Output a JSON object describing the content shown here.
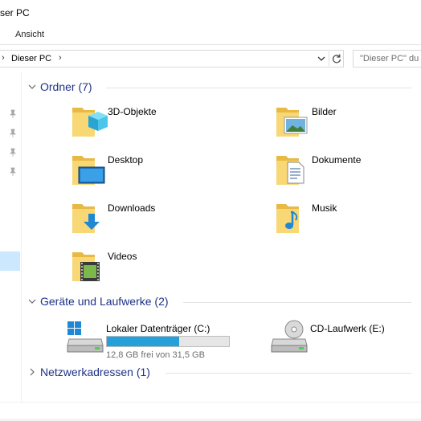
{
  "window": {
    "title": "ser PC"
  },
  "ribbon": {
    "tab_view": "Ansicht"
  },
  "address": {
    "crumb": "Dieser PC"
  },
  "search": {
    "placeholder": "\"Dieser PC\" du"
  },
  "groups": {
    "folders": {
      "title": "Ordner (7)",
      "expanded": true
    },
    "devices": {
      "title": "Geräte und Laufwerke (2)",
      "expanded": true
    },
    "network": {
      "title": "Netzwerkadressen (1)",
      "expanded": false
    }
  },
  "folders": [
    {
      "label": "3D-Objekte",
      "icon": "3d-objects-folder-icon"
    },
    {
      "label": "Bilder",
      "icon": "pictures-folder-icon"
    },
    {
      "label": "Desktop",
      "icon": "desktop-folder-icon"
    },
    {
      "label": "Dokumente",
      "icon": "documents-folder-icon"
    },
    {
      "label": "Downloads",
      "icon": "downloads-folder-icon"
    },
    {
      "label": "Musik",
      "icon": "music-folder-icon"
    },
    {
      "label": "Videos",
      "icon": "videos-folder-icon"
    }
  ],
  "drives": [
    {
      "name": "Lokaler Datenträger (C:)",
      "info": "12,8 GB frei von 31,5 GB",
      "used_fraction": 0.594,
      "icon": "local-disk-icon"
    },
    {
      "name": "CD-Laufwerk (E:)",
      "icon": "cd-drive-icon"
    }
  ],
  "colors": {
    "group_title": "#1e3287",
    "selection": "#cce8ff",
    "drive_bar": "#26a0da",
    "folder": "#f8d775"
  }
}
